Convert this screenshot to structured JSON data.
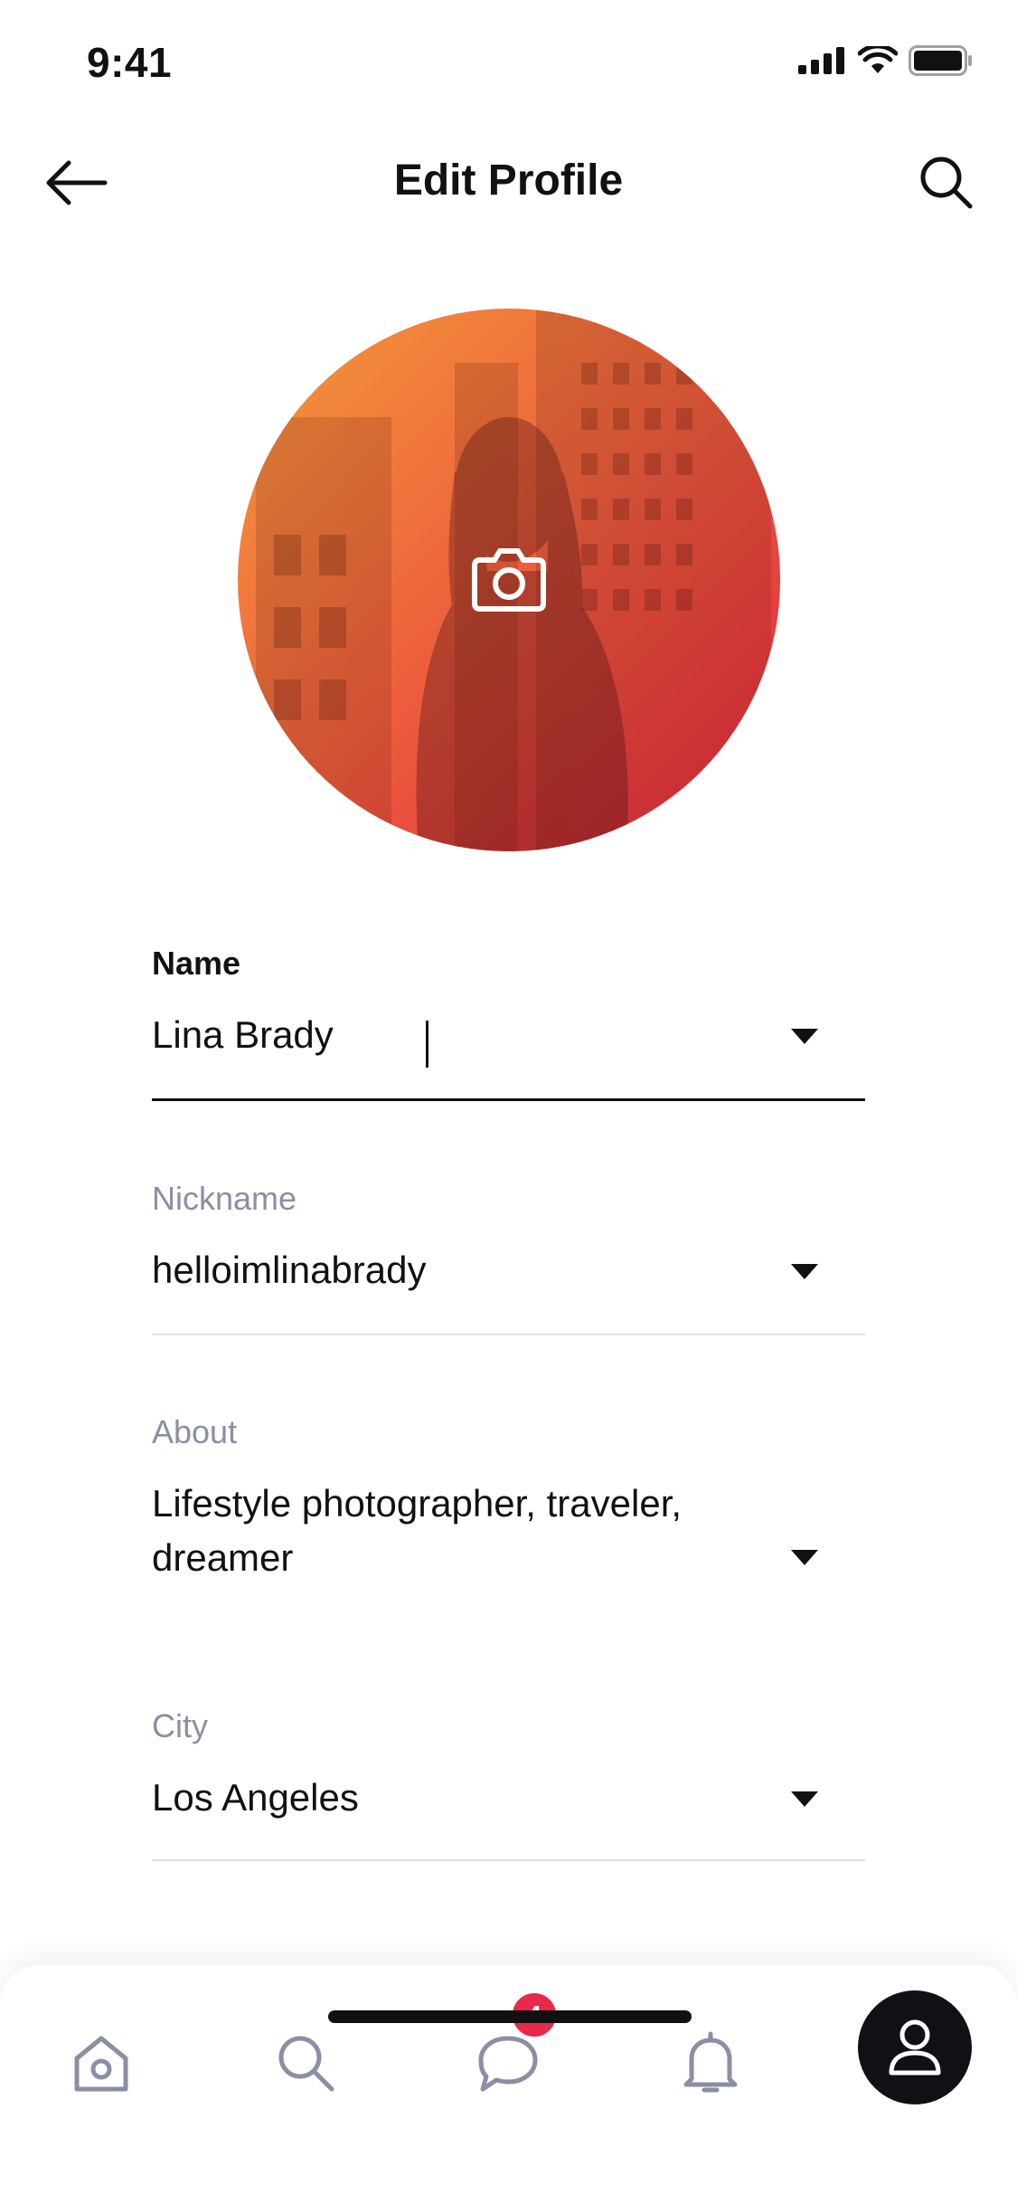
{
  "status_bar": {
    "time": "9:41"
  },
  "header": {
    "title": "Edit Profile"
  },
  "profile": {
    "photo_overlay": "gradient-orange-red"
  },
  "form": {
    "name": {
      "label": "Name",
      "value": "Lina Brady"
    },
    "nickname": {
      "label": "Nickname",
      "value": "helloimlinabrady"
    },
    "about": {
      "label": "About",
      "value": "Lifestyle photographer, traveler, dreamer"
    },
    "city": {
      "label": "City",
      "value": "Los Angeles"
    }
  },
  "bottom_nav": {
    "items": [
      {
        "icon": "home-icon"
      },
      {
        "icon": "search-icon"
      },
      {
        "icon": "chat-icon",
        "badge": "4"
      },
      {
        "icon": "bell-icon"
      },
      {
        "icon": "profile-icon",
        "active": true
      }
    ]
  },
  "colors": {
    "accent_dark": "#0f1117",
    "badge_red": "#e8294a",
    "muted_label": "#8a8fa3",
    "gradient_start": "#f58a35",
    "gradient_end": "#e5273e"
  }
}
